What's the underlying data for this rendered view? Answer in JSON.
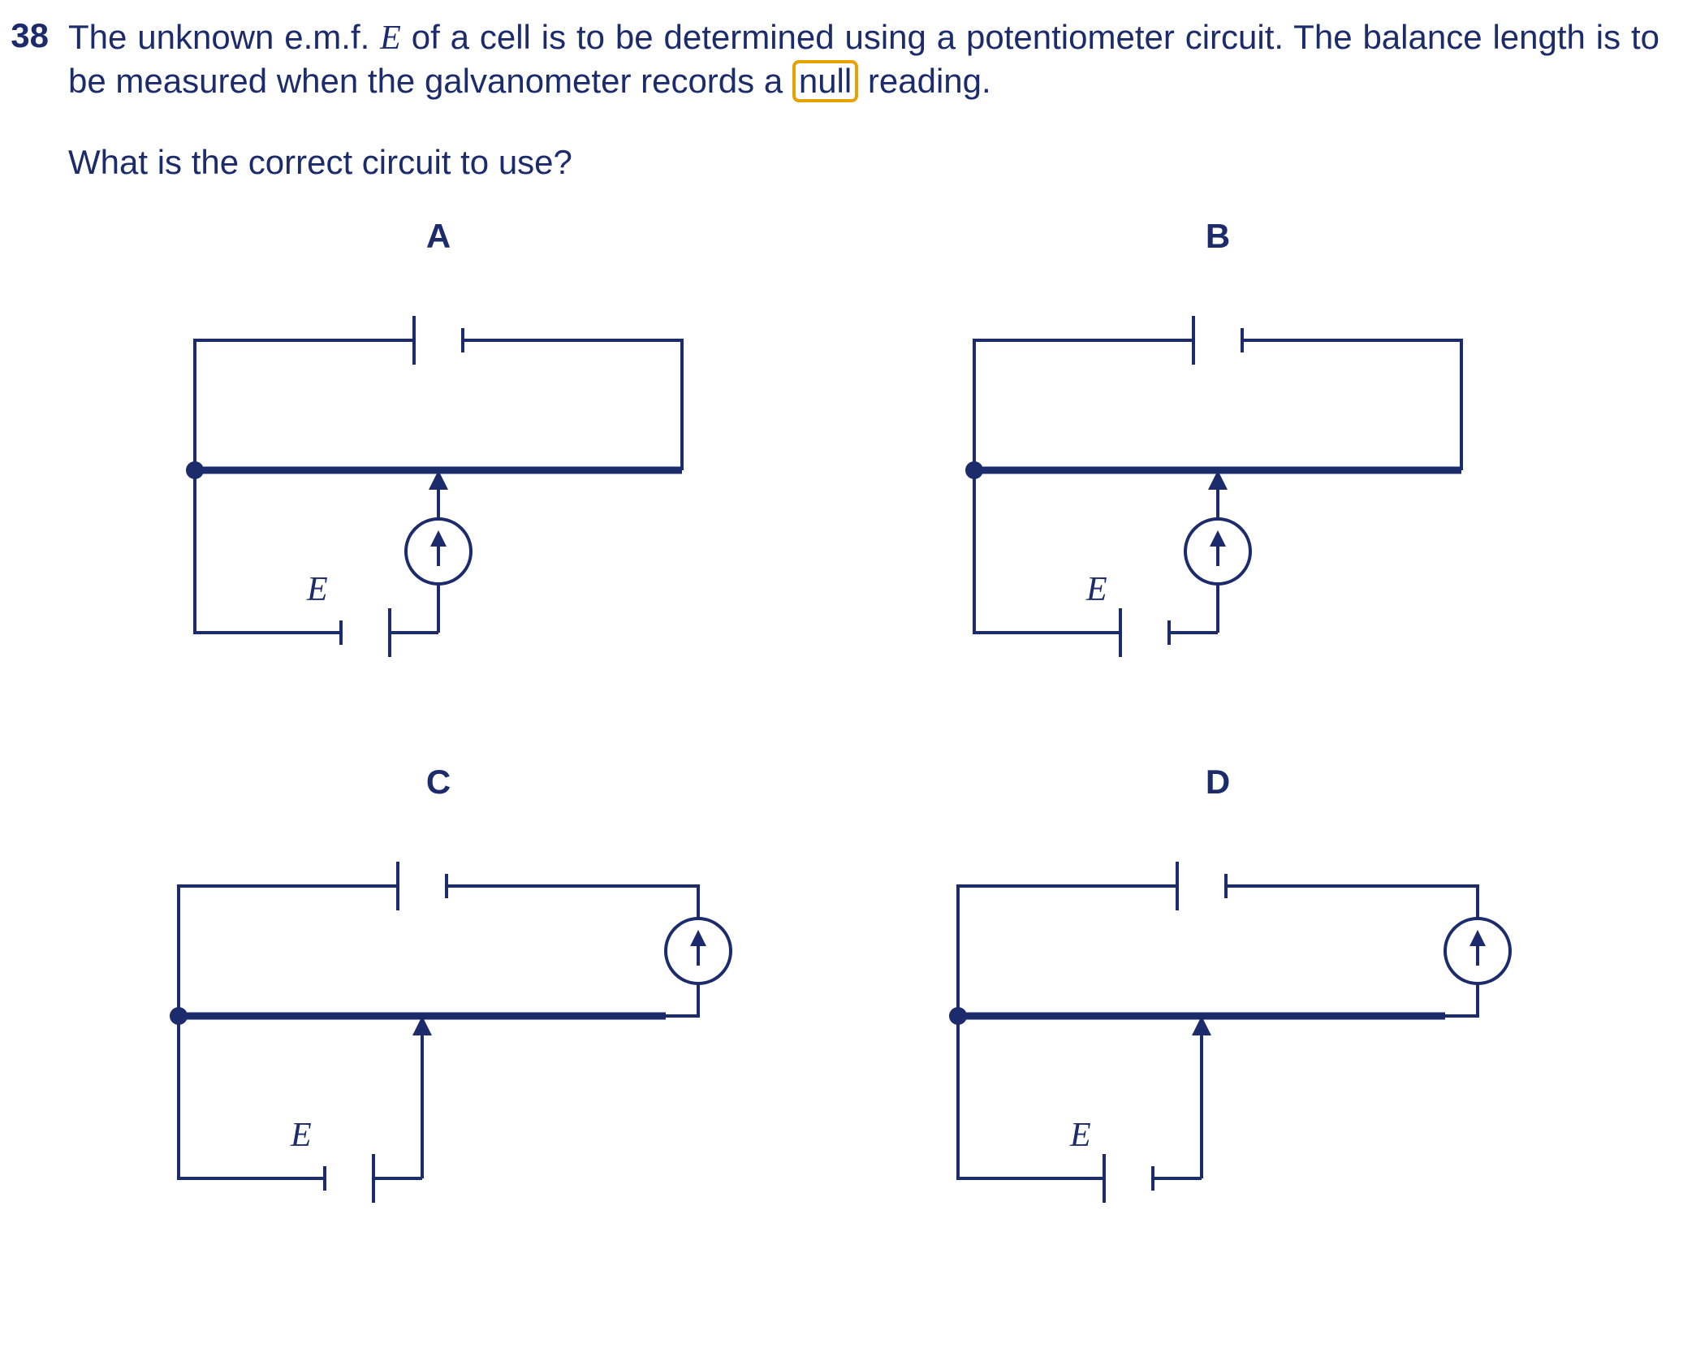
{
  "question": {
    "number": "38",
    "text_before_E": "The unknown e.m.f. ",
    "E_symbol": "E",
    "text_after_E": " of a cell is to be determined using a potentiometer circuit. The balance length is to be measured when the galvanometer records a ",
    "highlighted_word": "null",
    "text_after_highlight": " reading.",
    "prompt": "What is the correct circuit to use?"
  },
  "options": {
    "A": {
      "label": "A",
      "emf_label": "E"
    },
    "B": {
      "label": "B",
      "emf_label": "E"
    },
    "C": {
      "label": "C",
      "emf_label": "E"
    },
    "D": {
      "label": "D",
      "emf_label": "E"
    }
  },
  "diagram_meta": {
    "type": "circuit",
    "description": "Four potentiometer circuit options A–D. Each shows a driver cell across a potentiometer wire (thick horizontal line), a sliding contact (jockey arrow) on the wire, and an unknown-e.m.f. cell labelled E. A galvanometer (circle with upward-arrow symbol) is either in series with the jockey lead (A, B) or in series in the top driver loop at the right side (C, D). The orientation of cell E differs between A/C (positive plate to the right) and B/D (positive plate to the left).",
    "legend": {
      "thick_line": "potentiometer / resistance wire",
      "circle_with_arrow": "galvanometer",
      "short_and_long_parallel_lines": "cell (long line = positive terminal)"
    }
  }
}
